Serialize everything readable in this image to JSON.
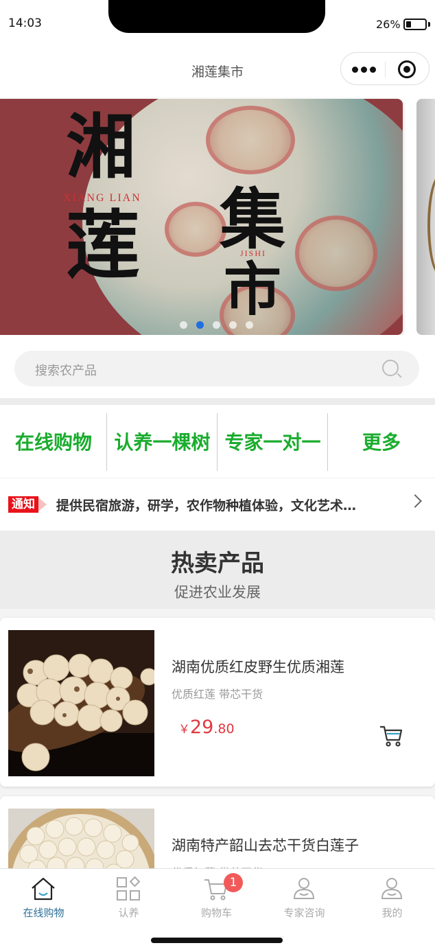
{
  "status": {
    "time": "14:03",
    "battery": "26%"
  },
  "nav": {
    "title": "湘莲集市"
  },
  "banner": {
    "title_chars": [
      "湘",
      "莲",
      "集",
      "市"
    ],
    "pinyin_left": "XIANG LIAN",
    "pinyin_right": "JISHI",
    "slide_count": 5,
    "active_slide": 2
  },
  "search": {
    "placeholder": "搜索农产品"
  },
  "menu": [
    "在线购物",
    "认养一棵树",
    "专家一对一",
    "更多"
  ],
  "notice": {
    "badge": "通知",
    "text": "提供民宿旅游，研学，农作物种植体验，文化艺术…"
  },
  "section": {
    "title": "热卖产品",
    "subtitle": "促进农业发展"
  },
  "products": [
    {
      "name": "湖南优质红皮野生优质湘莲",
      "tags": "优质红莲  带芯干货",
      "price_symbol": "￥",
      "price_int": "29",
      "price_dec": ".80"
    },
    {
      "name": "湖南特产韶山去芯干货白莲子",
      "tags": "优质红莲  带芯干货"
    }
  ],
  "tabs": [
    {
      "label": "在线购物",
      "icon": "home-icon"
    },
    {
      "label": "认养",
      "icon": "grid-icon"
    },
    {
      "label": "购物车",
      "icon": "cart-icon",
      "badge": "1"
    },
    {
      "label": "专家咨询",
      "icon": "person-icon"
    },
    {
      "label": "我的",
      "icon": "user-icon"
    }
  ],
  "colors": {
    "accent_green": "#1aac2e",
    "price_red": "#e0383f",
    "notice_red": "#e8121b",
    "tab_active": "#2d6f99"
  }
}
